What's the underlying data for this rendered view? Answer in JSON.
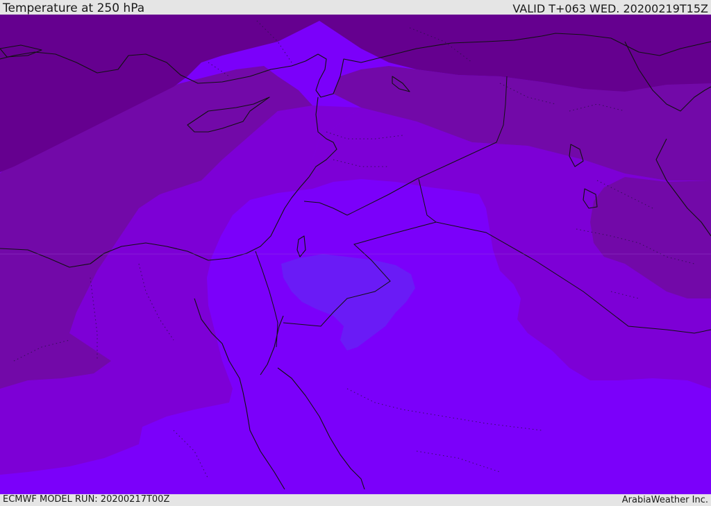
{
  "header": {
    "title": "Temperature at 250 hPa",
    "valid": "VALID T+063 WED. 20200219T15Z"
  },
  "footer": {
    "model_run": "ECMWF MODEL RUN: 20200217T00Z",
    "credit": "ArabiaWeather Inc."
  },
  "colors": {
    "band_darkest": "#65008f",
    "band_dark": "#7209a8",
    "band_mid": "#7d00d6",
    "band_bright": "#7b00fa",
    "band_core": "#6a1bf6",
    "frame": "#e5e5e5",
    "lines": "#111111"
  }
}
